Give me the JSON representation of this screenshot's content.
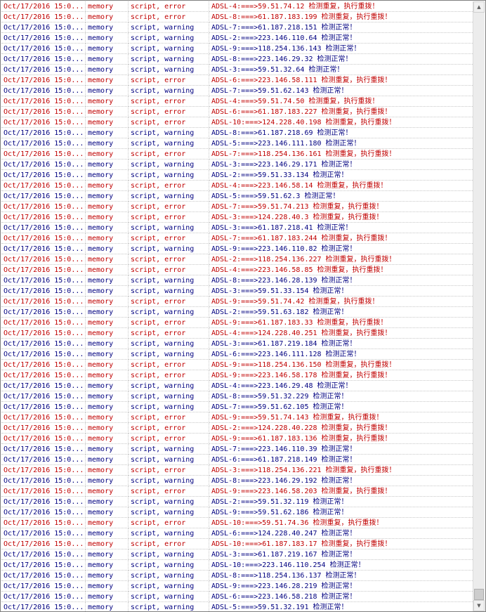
{
  "colors": {
    "error": "#c00000",
    "warning": "#000080",
    "grid": "#c8c8c8"
  },
  "scroll_icons": {
    "up": "triangle-up-icon",
    "down": "triangle-down-icon"
  },
  "scroll_position": 0.98,
  "rows": [
    {
      "time": "Oct/17/2016 15:0...",
      "source": "memory",
      "type": "script, error",
      "message": "ADSL-4:===>59.51.74.12 检测重复，执行重拨！",
      "severity": "error"
    },
    {
      "time": "Oct/17/2016 15:0...",
      "source": "memory",
      "type": "script, error",
      "message": "ADSL-8:===>61.187.183.199 检测重复，执行重拨！",
      "severity": "error"
    },
    {
      "time": "Oct/17/2016 15:0...",
      "source": "memory",
      "type": "script, warning",
      "message": "ADSL-7:===>61.187.218.151 检测正常！",
      "severity": "warning"
    },
    {
      "time": "Oct/17/2016 15:0...",
      "source": "memory",
      "type": "script, warning",
      "message": "ADSL-2:===>223.146.110.64 检测正常！",
      "severity": "warning"
    },
    {
      "time": "Oct/17/2016 15:0...",
      "source": "memory",
      "type": "script, warning",
      "message": "ADSL-9:===>118.254.136.143 检测正常！",
      "severity": "warning"
    },
    {
      "time": "Oct/17/2016 15:0...",
      "source": "memory",
      "type": "script, warning",
      "message": "ADSL-8:===>223.146.29.32 检测正常！",
      "severity": "warning"
    },
    {
      "time": "Oct/17/2016 15:0...",
      "source": "memory",
      "type": "script, warning",
      "message": "ADSL-3:===>59.51.32.64 检测正常！",
      "severity": "warning"
    },
    {
      "time": "Oct/17/2016 15:0...",
      "source": "memory",
      "type": "script, error",
      "message": "ADSL-6:===>223.146.58.111 检测重复，执行重拨！",
      "severity": "error"
    },
    {
      "time": "Oct/17/2016 15:0...",
      "source": "memory",
      "type": "script, warning",
      "message": "ADSL-7:===>59.51.62.143 检测正常！",
      "severity": "warning"
    },
    {
      "time": "Oct/17/2016 15:0...",
      "source": "memory",
      "type": "script, error",
      "message": "ADSL-4:===>59.51.74.50 检测重复，执行重拨！",
      "severity": "error"
    },
    {
      "time": "Oct/17/2016 15:0...",
      "source": "memory",
      "type": "script, error",
      "message": "ADSL-6:===>61.187.183.227 检测重复，执行重拨！",
      "severity": "error"
    },
    {
      "time": "Oct/17/2016 15:0...",
      "source": "memory",
      "type": "script, error",
      "message": "ADSL-10:===>124.228.40.198 检测重复，执行重拨！",
      "severity": "error"
    },
    {
      "time": "Oct/17/2016 15:0...",
      "source": "memory",
      "type": "script, warning",
      "message": "ADSL-8:===>61.187.218.69 检测正常！",
      "severity": "warning"
    },
    {
      "time": "Oct/17/2016 15:0...",
      "source": "memory",
      "type": "script, warning",
      "message": "ADSL-5:===>223.146.111.180 检测正常！",
      "severity": "warning"
    },
    {
      "time": "Oct/17/2016 15:0...",
      "source": "memory",
      "type": "script, error",
      "message": "ADSL-7:===>118.254.136.161 检测重复，执行重拨！",
      "severity": "error"
    },
    {
      "time": "Oct/17/2016 15:0...",
      "source": "memory",
      "type": "script, warning",
      "message": "ADSL-3:===>223.146.29.171 检测正常！",
      "severity": "warning"
    },
    {
      "time": "Oct/17/2016 15:0...",
      "source": "memory",
      "type": "script, warning",
      "message": "ADSL-2:===>59.51.33.134 检测正常！",
      "severity": "warning"
    },
    {
      "time": "Oct/17/2016 15:0...",
      "source": "memory",
      "type": "script, error",
      "message": "ADSL-4:===>223.146.58.14 检测重复，执行重拨！",
      "severity": "error"
    },
    {
      "time": "Oct/17/2016 15:0...",
      "source": "memory",
      "type": "script, warning",
      "message": "ADSL-5:===>59.51.62.3 检测正常！",
      "severity": "warning"
    },
    {
      "time": "Oct/17/2016 15:0...",
      "source": "memory",
      "type": "script, error",
      "message": "ADSL-7:===>59.51.74.213 检测重复，执行重拨！",
      "severity": "error"
    },
    {
      "time": "Oct/17/2016 15:0...",
      "source": "memory",
      "type": "script, error",
      "message": "ADSL-3:===>124.228.40.3 检测重复，执行重拨！",
      "severity": "error"
    },
    {
      "time": "Oct/17/2016 15:0...",
      "source": "memory",
      "type": "script, warning",
      "message": "ADSL-3:===>61.187.218.41 检测正常！",
      "severity": "warning"
    },
    {
      "time": "Oct/17/2016 15:0...",
      "source": "memory",
      "type": "script, error",
      "message": "ADSL-7:===>61.187.183.244 检测重复，执行重拨！",
      "severity": "error"
    },
    {
      "time": "Oct/17/2016 15:0...",
      "source": "memory",
      "type": "script, warning",
      "message": "ADSL-9:===>223.146.110.82 检测正常！",
      "severity": "warning"
    },
    {
      "time": "Oct/17/2016 15:0...",
      "source": "memory",
      "type": "script, error",
      "message": "ADSL-2:===>118.254.136.227 检测重复，执行重拨！",
      "severity": "error"
    },
    {
      "time": "Oct/17/2016 15:0...",
      "source": "memory",
      "type": "script, error",
      "message": "ADSL-4:===>223.146.58.85 检测重复，执行重拨！",
      "severity": "error"
    },
    {
      "time": "Oct/17/2016 15:0...",
      "source": "memory",
      "type": "script, warning",
      "message": "ADSL-8:===>223.146.28.139 检测正常！",
      "severity": "warning"
    },
    {
      "time": "Oct/17/2016 15:0...",
      "source": "memory",
      "type": "script, warning",
      "message": "ADSL-3:===>59.51.33.154 检测正常！",
      "severity": "warning"
    },
    {
      "time": "Oct/17/2016 15:0...",
      "source": "memory",
      "type": "script, error",
      "message": "ADSL-9:===>59.51.74.42 检测重复，执行重拨！",
      "severity": "error"
    },
    {
      "time": "Oct/17/2016 15:0...",
      "source": "memory",
      "type": "script, warning",
      "message": "ADSL-2:===>59.51.63.182 检测正常！",
      "severity": "warning"
    },
    {
      "time": "Oct/17/2016 15:0...",
      "source": "memory",
      "type": "script, error",
      "message": "ADSL-9:===>61.187.183.33 检测重复，执行重拨！",
      "severity": "error"
    },
    {
      "time": "Oct/17/2016 15:0...",
      "source": "memory",
      "type": "script, error",
      "message": "ADSL-4:===>124.228.40.251 检测重复，执行重拨！",
      "severity": "error"
    },
    {
      "time": "Oct/17/2016 15:0...",
      "source": "memory",
      "type": "script, warning",
      "message": "ADSL-3:===>61.187.219.184 检测正常！",
      "severity": "warning"
    },
    {
      "time": "Oct/17/2016 15:0...",
      "source": "memory",
      "type": "script, warning",
      "message": "ADSL-6:===>223.146.111.128 检测正常！",
      "severity": "warning"
    },
    {
      "time": "Oct/17/2016 15:0...",
      "source": "memory",
      "type": "script, error",
      "message": "ADSL-9:===>118.254.136.150 检测重复，执行重拨！",
      "severity": "error"
    },
    {
      "time": "Oct/17/2016 15:0...",
      "source": "memory",
      "type": "script, error",
      "message": "ADSL-9:===>223.146.58.178 检测重复，执行重拨！",
      "severity": "error"
    },
    {
      "time": "Oct/17/2016 15:0...",
      "source": "memory",
      "type": "script, warning",
      "message": "ADSL-4:===>223.146.29.48 检测正常！",
      "severity": "warning"
    },
    {
      "time": "Oct/17/2016 15:0...",
      "source": "memory",
      "type": "script, warning",
      "message": "ADSL-8:===>59.51.32.229 检测正常！",
      "severity": "warning"
    },
    {
      "time": "Oct/17/2016 15:0...",
      "source": "memory",
      "type": "script, warning",
      "message": "ADSL-7:===>59.51.62.105 检测正常！",
      "severity": "warning"
    },
    {
      "time": "Oct/17/2016 15:0...",
      "source": "memory",
      "type": "script, error",
      "message": "ADSL-9:===>59.51.74.143 检测重复，执行重拨！",
      "severity": "error"
    },
    {
      "time": "Oct/17/2016 15:0...",
      "source": "memory",
      "type": "script, error",
      "message": "ADSL-2:===>124.228.40.228 检测重复，执行重拨！",
      "severity": "error"
    },
    {
      "time": "Oct/17/2016 15:0...",
      "source": "memory",
      "type": "script, error",
      "message": "ADSL-9:===>61.187.183.136 检测重复，执行重拨！",
      "severity": "error"
    },
    {
      "time": "Oct/17/2016 15:0...",
      "source": "memory",
      "type": "script, warning",
      "message": "ADSL-7:===>223.146.110.39 检测正常！",
      "severity": "warning"
    },
    {
      "time": "Oct/17/2016 15:0...",
      "source": "memory",
      "type": "script, warning",
      "message": "ADSL-6:===>61.187.218.149 检测正常！",
      "severity": "warning"
    },
    {
      "time": "Oct/17/2016 15:0...",
      "source": "memory",
      "type": "script, error",
      "message": "ADSL-3:===>118.254.136.221 检测重复，执行重拨！",
      "severity": "error"
    },
    {
      "time": "Oct/17/2016 15:0...",
      "source": "memory",
      "type": "script, warning",
      "message": "ADSL-8:===>223.146.29.192 检测正常！",
      "severity": "warning"
    },
    {
      "time": "Oct/17/2016 15:0...",
      "source": "memory",
      "type": "script, error",
      "message": "ADSL-9:===>223.146.58.203 检测重复，执行重拨！",
      "severity": "error"
    },
    {
      "time": "Oct/17/2016 15:0...",
      "source": "memory",
      "type": "script, warning",
      "message": "ADSL-2:===>59.51.32.119 检测正常！",
      "severity": "warning"
    },
    {
      "time": "Oct/17/2016 15:0...",
      "source": "memory",
      "type": "script, warning",
      "message": "ADSL-9:===>59.51.62.186 检测正常！",
      "severity": "warning"
    },
    {
      "time": "Oct/17/2016 15:0...",
      "source": "memory",
      "type": "script, error",
      "message": "ADSL-10:===>59.51.74.36 检测重复，执行重拨！",
      "severity": "error"
    },
    {
      "time": "Oct/17/2016 15:0...",
      "source": "memory",
      "type": "script, warning",
      "message": "ADSL-6:===>124.228.40.247 检测正常！",
      "severity": "warning"
    },
    {
      "time": "Oct/17/2016 15:0...",
      "source": "memory",
      "type": "script, error",
      "message": "ADSL-10:===>61.187.183.17 检测重复，执行重拨！",
      "severity": "error"
    },
    {
      "time": "Oct/17/2016 15:0...",
      "source": "memory",
      "type": "script, warning",
      "message": "ADSL-3:===>61.187.219.167 检测正常！",
      "severity": "warning"
    },
    {
      "time": "Oct/17/2016 15:0...",
      "source": "memory",
      "type": "script, warning",
      "message": "ADSL-10:===>223.146.110.254 检测正常！",
      "severity": "warning"
    },
    {
      "time": "Oct/17/2016 15:0...",
      "source": "memory",
      "type": "script, warning",
      "message": "ADSL-8:===>118.254.136.137 检测正常！",
      "severity": "warning"
    },
    {
      "time": "Oct/17/2016 15:0...",
      "source": "memory",
      "type": "script, warning",
      "message": "ADSL-9:===>223.146.28.219 检测正常！",
      "severity": "warning"
    },
    {
      "time": "Oct/17/2016 15:0...",
      "source": "memory",
      "type": "script, warning",
      "message": "ADSL-6:===>223.146.58.218 检测正常！",
      "severity": "warning"
    },
    {
      "time": "Oct/17/2016 15:0...",
      "source": "memory",
      "type": "script, warning",
      "message": "ADSL-5:===>59.51.32.191 检测正常！",
      "severity": "warning"
    }
  ]
}
